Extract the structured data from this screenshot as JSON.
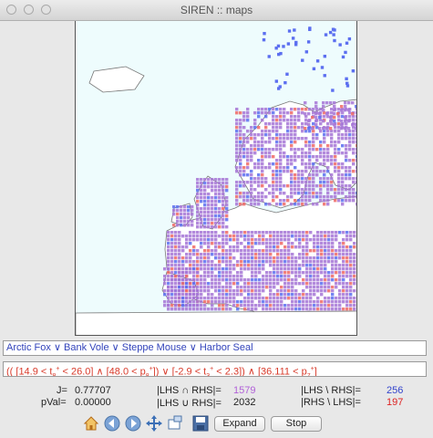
{
  "window": {
    "title": "SIREN :: maps"
  },
  "query": {
    "lhs_text": "Arctic Fox ∨ Bank Vole ∨ Steppe Mouse ∨ Harbor Seal",
    "rhs": {
      "p1": "(( [14.9 < t",
      "p1_sub": "8",
      "p1_sup": "+",
      "p2": " < 26.0] ∧ [48.0 < p",
      "p2_sub": "8",
      "p2_sup": "+",
      "p3": "]) ∨ [-2.9 < t",
      "p3_sub": "3",
      "p3_sup": "+",
      "p4": " < 2.3]) ∧ [36.111 < p",
      "p4_sub": "7",
      "p4_sup": "+",
      "p5": "]"
    }
  },
  "stats": {
    "j_label": "J=",
    "j_value": "0.77707",
    "pval_label": "pVal=",
    "pval_value": "0.00000",
    "inter_label": "|LHS ∩ RHS|=",
    "inter_value": "1579",
    "union_label": "|LHS ∪ RHS|=",
    "union_value": "2032",
    "lminusr_label": "|LHS \\ RHS|=",
    "lminusr_value": "256",
    "rminusl_label": "|RHS \\ LHS|=",
    "rminusl_value": "197"
  },
  "toolbar": {
    "icons": [
      "home-icon",
      "back-icon",
      "forward-icon",
      "pan-icon",
      "zoom-icon",
      "save-icon"
    ],
    "expand_label": "Expand",
    "stop_label": "Stop"
  },
  "colors": {
    "both": "#a676d6",
    "lhs_only": "#5c6ff0",
    "rhs_only": "#ee6a66",
    "sea": "#eefcfd",
    "land": "#ffffff",
    "coast": "#777777"
  }
}
